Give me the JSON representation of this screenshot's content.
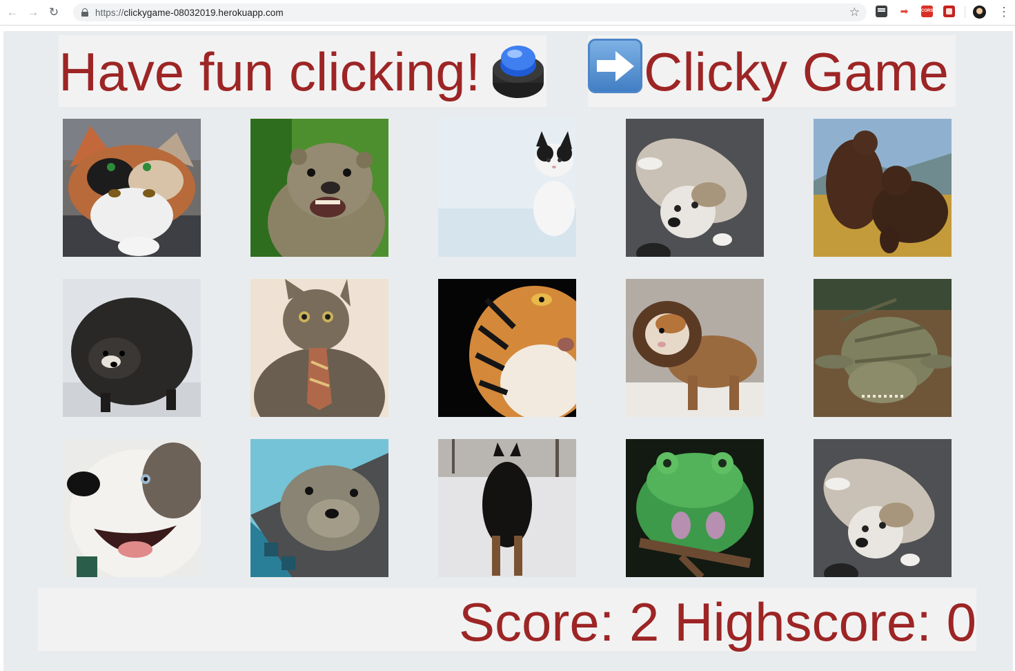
{
  "browser": {
    "url_protocol": "https://",
    "url_host": "clickygame-08032019.herokuapp.com",
    "extensions": [
      "menu-extension-icon",
      "arrow-extension-icon",
      "cors-extension-icon",
      "red-extension-icon"
    ],
    "cors_badge": "CORS"
  },
  "header": {
    "left_title": "Have fun clicking!",
    "right_title": "Clicky Game",
    "left_icon": "red-buzzer-button-icon",
    "right_icon": "right-arrow-icon"
  },
  "cards": [
    {
      "animal": "calico-cat"
    },
    {
      "animal": "otter"
    },
    {
      "animal": "kitten-in-snow"
    },
    {
      "animal": "terrier-puppy"
    },
    {
      "animal": "fighting-bears"
    },
    {
      "animal": "raccoon-dog"
    },
    {
      "animal": "cat-with-tie"
    },
    {
      "animal": "tiger"
    },
    {
      "animal": "guinea-pig-lion"
    },
    {
      "animal": "crocodile"
    },
    {
      "animal": "husky"
    },
    {
      "animal": "seal"
    },
    {
      "animal": "black-shepherd-dog"
    },
    {
      "animal": "green-frog"
    },
    {
      "animal": "terrier-puppy"
    }
  ],
  "footer": {
    "score_label": "Score: ",
    "score": "2",
    "highscore_label": "Highscore: ",
    "highscore": "0"
  },
  "colors": {
    "title_red": "#9d2525",
    "page_bg": "#e9ecee",
    "jumbotron_bg": "#f2f2f2"
  }
}
